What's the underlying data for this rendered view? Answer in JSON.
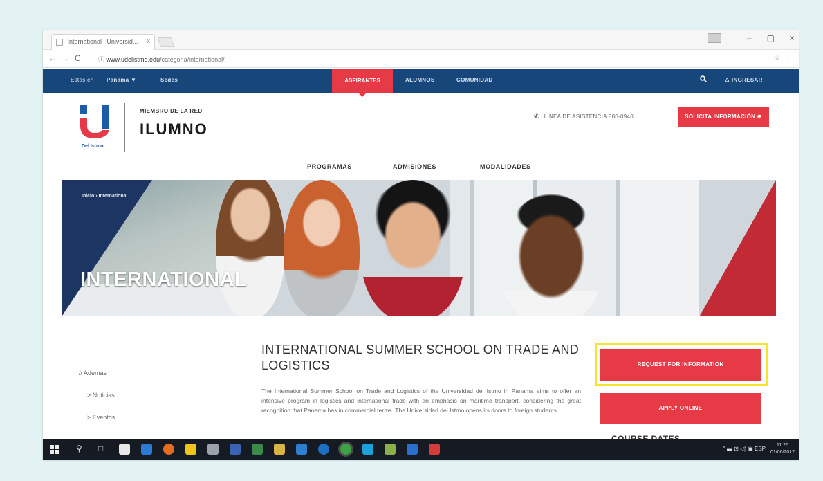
{
  "browser": {
    "tab_title": "International | Universid...",
    "tab_close": "x",
    "url_host": "www.udelistmo.edu",
    "url_path": "/categoria/international/",
    "back": "←",
    "forward": "→",
    "reload": "C",
    "info": "ⓘ",
    "minimize": "–",
    "maximize": "▢",
    "close": "×",
    "star": "☆",
    "menu": "⋮"
  },
  "topbar": {
    "lang": "Estás en",
    "country": "Panamá",
    "search": "Sedes",
    "tabs": [
      "ASPIRANTES",
      "ALUMNOS",
      "COMUNIDAD"
    ],
    "search_icon": "search-icon",
    "login": "INGRESAR"
  },
  "header": {
    "member_text": "MIEMBRO DE LA RED",
    "brand": "ILUMNO",
    "logo_caption": "Del Istmo",
    "helpline": "LÍNEA DE ASISTENCIA 800-0940",
    "cta": "SOLICITA INFORMACIÓN ⊕"
  },
  "mainnav": [
    "PROGRAMAS",
    "ADMISIONES",
    "MODALIDADES"
  ],
  "hero": {
    "breadcrumb": "Inicio › International",
    "title": "INTERNATIONAL"
  },
  "sidebar": {
    "label": "// Además",
    "items": [
      "> Noticias",
      "> Eventos"
    ]
  },
  "article": {
    "title": "INTERNATIONAL SUMMER SCHOOL ON TRADE AND LOGISTICS",
    "body": "The International Summer School on Trade and Logistics of the Universidad del Istmo in Panama aims to offer an intensive program in logistics and international trade with an emphasis on maritime transport, considering the great recognition that Panama has in commercial terms. The Universidad del Istmo opens its doors to foreign students"
  },
  "actions": {
    "request": "REQUEST FOR INFORMATION",
    "apply": "APPLY ONLINE",
    "subheading": "COURSE DATES"
  },
  "taskbar": {
    "tray": "^ ▬ ⊡ ◁) ▣ ESP",
    "time": "11:26",
    "date": "01/06/2017"
  },
  "colors": {
    "brand_navy": "#17467a",
    "brand_red": "#e63a46",
    "highlight": "#f4e62c"
  }
}
